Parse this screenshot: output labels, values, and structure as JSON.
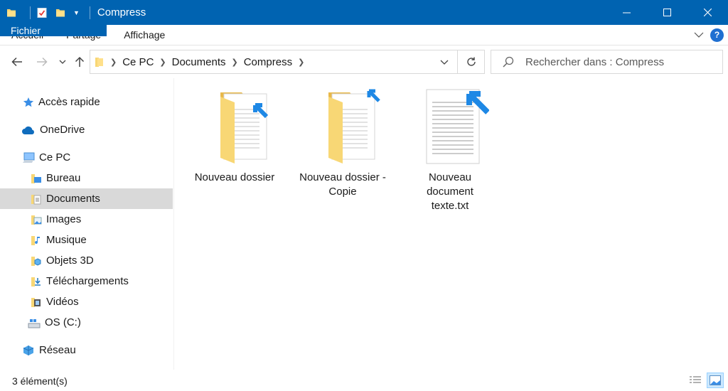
{
  "window": {
    "title": "Compress",
    "controls": {
      "minimize": "minimize",
      "maximize": "maximize",
      "close": "close"
    }
  },
  "ribbon": {
    "tabs": [
      "Fichier",
      "Accueil",
      "Partage",
      "Affichage"
    ],
    "help_label": "?"
  },
  "address": {
    "crumbs": [
      "Ce PC",
      "Documents",
      "Compress"
    ],
    "search_placeholder": "Rechercher dans : Compress"
  },
  "sidebar": {
    "items": [
      {
        "label": "Accès rapide",
        "icon": "star-icon"
      },
      {
        "label": "OneDrive",
        "icon": "cloud-icon"
      },
      {
        "label": "Ce PC",
        "icon": "computer-icon"
      },
      {
        "label": "Bureau",
        "icon": "desktop-folder-icon"
      },
      {
        "label": "Documents",
        "icon": "documents-folder-icon",
        "selected": true
      },
      {
        "label": "Images",
        "icon": "pictures-folder-icon"
      },
      {
        "label": "Musique",
        "icon": "music-folder-icon"
      },
      {
        "label": "Objets 3D",
        "icon": "objects3d-folder-icon"
      },
      {
        "label": "Téléchargements",
        "icon": "downloads-folder-icon"
      },
      {
        "label": "Vidéos",
        "icon": "videos-folder-icon"
      },
      {
        "label": "OS (C:)",
        "icon": "drive-icon"
      },
      {
        "label": "Réseau",
        "icon": "network-icon"
      }
    ]
  },
  "files": [
    {
      "name": "Nouveau dossier",
      "type": "compressed-folder"
    },
    {
      "name": "Nouveau dossier - Copie",
      "type": "compressed-folder"
    },
    {
      "name": "Nouveau document texte.txt",
      "type": "compressed-text-file"
    }
  ],
  "status": {
    "count": "3 élément(s)"
  },
  "colors": {
    "titlebar": "#0063b1",
    "selection": "#d9d9d9",
    "compress_arrow": "#1e88e5",
    "folder": "#f8d775"
  }
}
